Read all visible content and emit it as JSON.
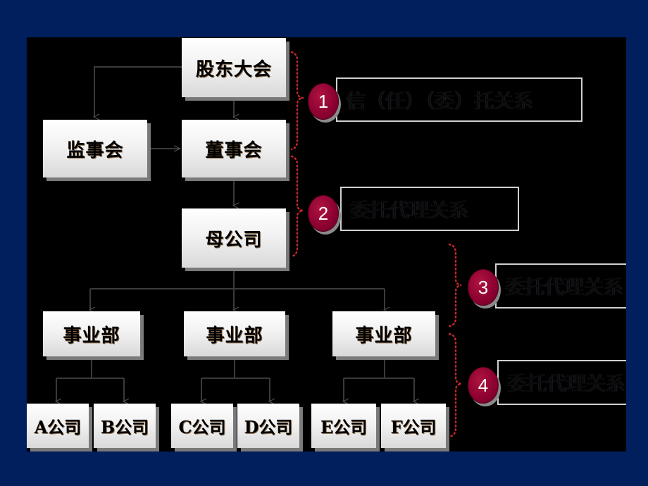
{
  "org_chart": {
    "shareholders_meeting": "股东大会",
    "supervisory_board": "监事会",
    "board_of_directors": "董事会",
    "parent_company": "母公司",
    "divisions": [
      "事业部",
      "事业部",
      "事业部"
    ],
    "subsidiaries": [
      "A公司",
      "B公司",
      "C公司",
      "D公司",
      "E公司",
      "F公司"
    ]
  },
  "relations": [
    {
      "number": "1",
      "label": "信（任）（委）托关系"
    },
    {
      "number": "2",
      "label": "委托代理关系"
    },
    {
      "number": "3",
      "label": "委托代理关系"
    },
    {
      "number": "4",
      "label": "委托代理关系"
    }
  ],
  "colors": {
    "background": "#001f5c",
    "stage": "#000000",
    "badge": "#8a0030",
    "brace": "#c0282a",
    "connector": "#3a3a3a"
  }
}
